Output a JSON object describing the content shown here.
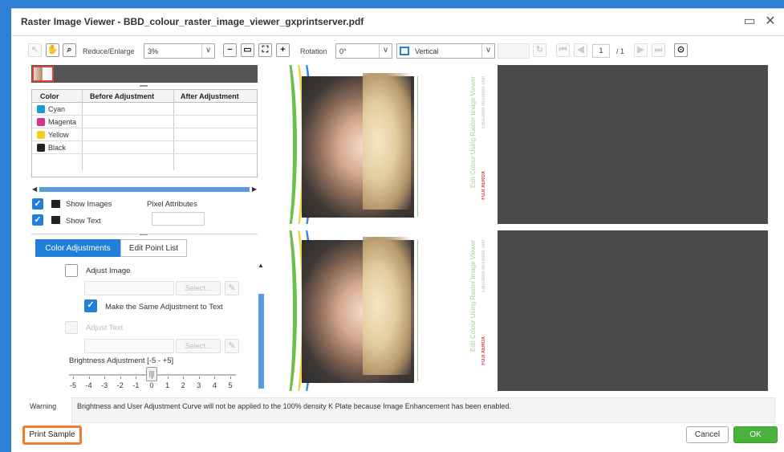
{
  "window": {
    "title": "Raster Image Viewer - BBD_colour_raster_image_viewer_gxprintserver.pdf"
  },
  "toolbar": {
    "reduce_enlarge_label": "Reduce/Enlarge",
    "zoom_value": "3%",
    "rotation_label": "Rotation",
    "rotation_value": "0°",
    "orientation_value": "Vertical",
    "page_current": "1",
    "page_total": "/ 1"
  },
  "color_table": {
    "headers": [
      "Color",
      "Before Adjustment",
      "After Adjustment"
    ],
    "rows": [
      {
        "name": "Cyan",
        "color": "#1a9bd7"
      },
      {
        "name": "Magenta",
        "color": "#d6338f"
      },
      {
        "name": "Yellow",
        "color": "#f4d21b"
      },
      {
        "name": "Black",
        "color": "#222222"
      }
    ]
  },
  "options": {
    "show_images": "Show Images",
    "pixel_attributes": "Pixel Attributes",
    "show_text": "Show Text"
  },
  "tabs": {
    "color_adjustments": "Color Adjustments",
    "edit_point_list": "Edit Point List"
  },
  "adjust": {
    "adjust_image": "Adjust Image",
    "select": "Select...",
    "same_adjustment": "Make the Same Adjustment to Text",
    "adjust_text": "Adjust Text",
    "brightness_label": "Brightness Adjustment [-5 - +5]",
    "brightness_value": 0,
    "ticks": [
      "-5",
      "-4",
      "-3",
      "-2",
      "-1",
      "0",
      "1",
      "2",
      "3",
      "4",
      "5"
    ]
  },
  "warning": {
    "label": "Warning",
    "text": "Brightness and User Adjustment Curve will not be applied to the 100% density K Plate because Image Enhancement has been enabled."
  },
  "preview": {
    "doc_title": "Edit Colour Using Raster Image Viewer",
    "doc_subtitle": "Education Business Unit",
    "brand": "FUJI XEROX"
  },
  "footer": {
    "print_sample": "Print Sample",
    "cancel": "Cancel",
    "ok": "OK"
  },
  "colors": {
    "accent": "#1f7fd9",
    "ok_green": "#48b23b",
    "highlight": "#f07d2b"
  }
}
